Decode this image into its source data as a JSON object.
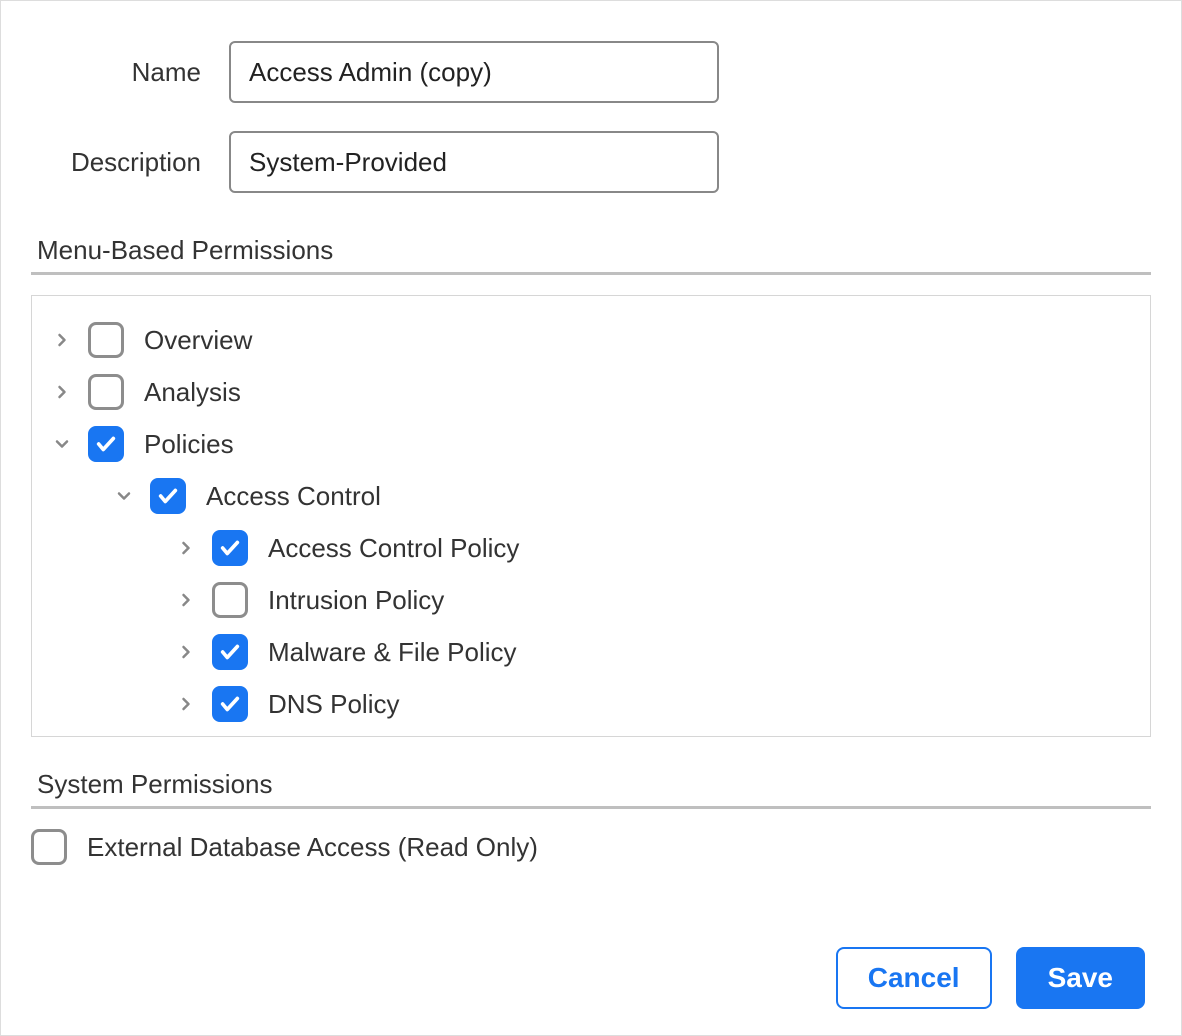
{
  "form": {
    "name_label": "Name",
    "name_value": "Access Admin (copy)",
    "desc_label": "Description",
    "desc_value": "System-Provided"
  },
  "sections": {
    "menu_title": "Menu-Based Permissions",
    "system_title": "System Permissions"
  },
  "tree": [
    {
      "indent": 0,
      "chevron": "right",
      "checked": false,
      "label": "Overview"
    },
    {
      "indent": 0,
      "chevron": "right",
      "checked": false,
      "label": "Analysis"
    },
    {
      "indent": 0,
      "chevron": "down",
      "checked": true,
      "label": "Policies"
    },
    {
      "indent": 1,
      "chevron": "down",
      "checked": true,
      "label": "Access Control"
    },
    {
      "indent": 2,
      "chevron": "right",
      "checked": true,
      "label": "Access Control Policy"
    },
    {
      "indent": 2,
      "chevron": "right",
      "checked": false,
      "label": "Intrusion Policy"
    },
    {
      "indent": 2,
      "chevron": "right",
      "checked": true,
      "label": "Malware & File Policy"
    },
    {
      "indent": 2,
      "chevron": "right",
      "checked": true,
      "label": "DNS Policy"
    }
  ],
  "system": {
    "ext_db_checked": false,
    "ext_db_label": "External Database Access (Read Only)"
  },
  "buttons": {
    "cancel": "Cancel",
    "save": "Save"
  }
}
